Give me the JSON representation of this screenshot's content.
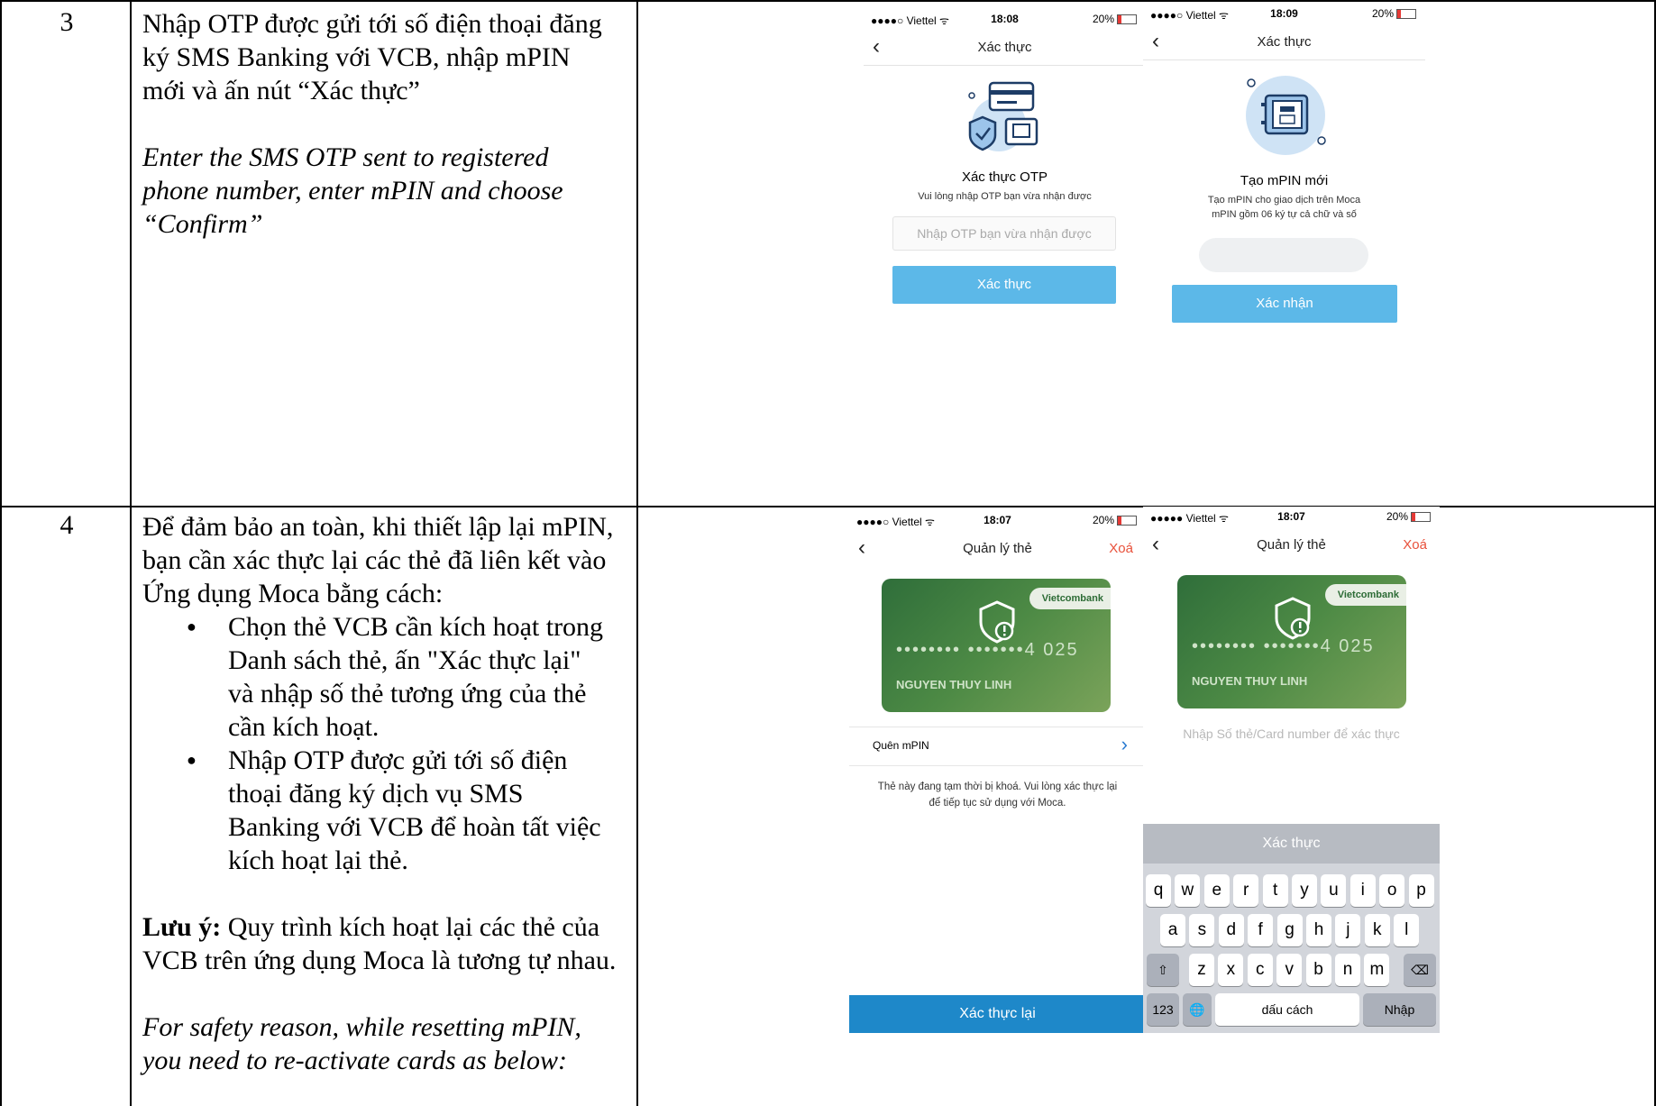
{
  "rows": [
    {
      "number": "3",
      "vi_text": "Nhập OTP được gửi tới số điện thoại đăng ký SMS Banking với VCB, nhập mPIN mới và ấn nút “Xác thực”",
      "en_text": "Enter the SMS OTP sent to registered phone number, enter mPIN and choose “Confirm”"
    },
    {
      "number": "4",
      "vi_intro": "Để đảm bảo an toàn, khi thiết lập lại mPIN, bạn cần xác thực lại các thẻ đã liên kết vào Ứng dụng Moca bằng cách:",
      "bullets": [
        "Chọn thẻ VCB cần kích hoạt trong Danh sách thẻ, ấn \"Xác thực lại\" và nhập số thẻ tương ứng của thẻ cần kích hoạt.",
        "Nhập OTP được gửi tới số điện thoại đăng ký dịch vụ SMS Banking với VCB để hoàn tất việc kích hoạt lại thẻ."
      ],
      "note_label": "Lưu ý:",
      "note_text": " Quy trình kích hoạt lại các thẻ của VCB trên ứng dụng Moca là tương tự nhau.",
      "en_text": "For safety reason, while resetting mPIN, you need to re-activate cards as below:"
    }
  ],
  "screens": {
    "otp": {
      "carrier": "●●●●○ Viettel ᯤ",
      "time": "18:08",
      "battery": "20%",
      "title": "Xác thực",
      "heading": "Xác thực OTP",
      "sub": "Vui lòng nhập OTP bạn vừa nhận được",
      "placeholder": "Nhập OTP bạn vừa nhận được",
      "button": "Xác thực"
    },
    "mpin": {
      "carrier": "●●●●○ Viettel ᯤ",
      "time": "18:09",
      "battery": "20%",
      "title": "Xác thực",
      "heading": "Tạo mPIN mới",
      "sub1": "Tạo mPIN cho giao dịch trên Moca",
      "sub2": "mPIN gồm 06 ký tự cả chữ và số",
      "button": "Xác nhận"
    },
    "cards1": {
      "carrier": "●●●●○ Viettel ᯤ",
      "time": "18:07",
      "battery": "20%",
      "title": "Quản lý thẻ",
      "delete": "Xoá",
      "bank": "Vietcombank",
      "card_number": "•••••••• •••••••4 025",
      "card_name": "NGUYEN THUY LINH",
      "forgot": "Quên mPIN",
      "notice": "Thẻ này đang tạm thời bị khoá. Vui lòng xác thực lại để tiếp tục sử dụng với Moca.",
      "button": "Xác thực lại"
    },
    "cards2": {
      "carrier": "●●●●● Viettel ᯤ",
      "time": "18:07",
      "battery": "20%",
      "title": "Quản lý thẻ",
      "delete": "Xoá",
      "bank": "Vietcombank",
      "card_number": "•••••••• •••••••4 025",
      "card_name": "NGUYEN THUY LINH",
      "placeholder": "Nhập Số thẻ/Card number để xác thực",
      "bar": "Xác thực",
      "kb_row1": [
        "q",
        "w",
        "e",
        "r",
        "t",
        "y",
        "u",
        "i",
        "o",
        "p"
      ],
      "kb_row2": [
        "a",
        "s",
        "d",
        "f",
        "g",
        "h",
        "j",
        "k",
        "l"
      ],
      "kb_row3": [
        "z",
        "x",
        "c",
        "v",
        "b",
        "n",
        "m"
      ],
      "kb_123": "123",
      "kb_space": "dấu cách",
      "kb_enter": "Nhập"
    }
  }
}
